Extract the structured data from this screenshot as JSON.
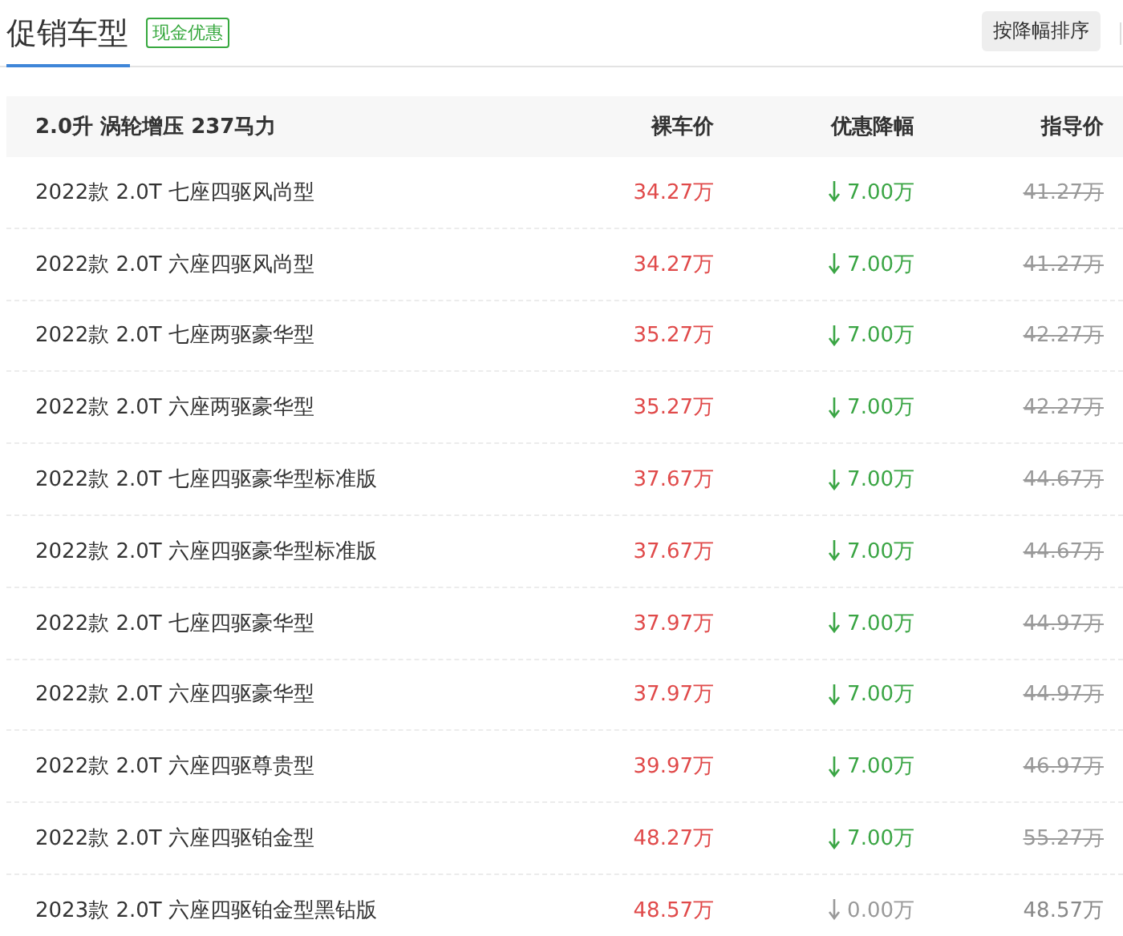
{
  "header": {
    "title": "促销车型",
    "badge": "现金优惠",
    "sort_button": "按降幅排序"
  },
  "table": {
    "columns": [
      "2.0升 涡轮增压 237马力",
      "裸车价",
      "优惠降幅",
      "指导价"
    ],
    "rows": [
      {
        "name": "2022款 2.0T 七座四驱风尚型",
        "price": "34.27万",
        "discount": "7.00万",
        "guide": "41.27万",
        "discounted": true
      },
      {
        "name": "2022款 2.0T 六座四驱风尚型",
        "price": "34.27万",
        "discount": "7.00万",
        "guide": "41.27万",
        "discounted": true
      },
      {
        "name": "2022款 2.0T 七座两驱豪华型",
        "price": "35.27万",
        "discount": "7.00万",
        "guide": "42.27万",
        "discounted": true
      },
      {
        "name": "2022款 2.0T 六座两驱豪华型",
        "price": "35.27万",
        "discount": "7.00万",
        "guide": "42.27万",
        "discounted": true
      },
      {
        "name": "2022款 2.0T 七座四驱豪华型标准版",
        "price": "37.67万",
        "discount": "7.00万",
        "guide": "44.67万",
        "discounted": true
      },
      {
        "name": "2022款 2.0T 六座四驱豪华型标准版",
        "price": "37.67万",
        "discount": "7.00万",
        "guide": "44.67万",
        "discounted": true
      },
      {
        "name": "2022款 2.0T 七座四驱豪华型",
        "price": "37.97万",
        "discount": "7.00万",
        "guide": "44.97万",
        "discounted": true
      },
      {
        "name": "2022款 2.0T 六座四驱豪华型",
        "price": "37.97万",
        "discount": "7.00万",
        "guide": "44.97万",
        "discounted": true
      },
      {
        "name": "2022款 2.0T 六座四驱尊贵型",
        "price": "39.97万",
        "discount": "7.00万",
        "guide": "46.97万",
        "discounted": true
      },
      {
        "name": "2022款 2.0T 六座四驱铂金型",
        "price": "48.27万",
        "discount": "7.00万",
        "guide": "55.27万",
        "discounted": true
      },
      {
        "name": "2023款 2.0T 六座四驱铂金型黑钻版",
        "price": "48.57万",
        "discount": "0.00万",
        "guide": "48.57万",
        "discounted": false
      }
    ]
  }
}
